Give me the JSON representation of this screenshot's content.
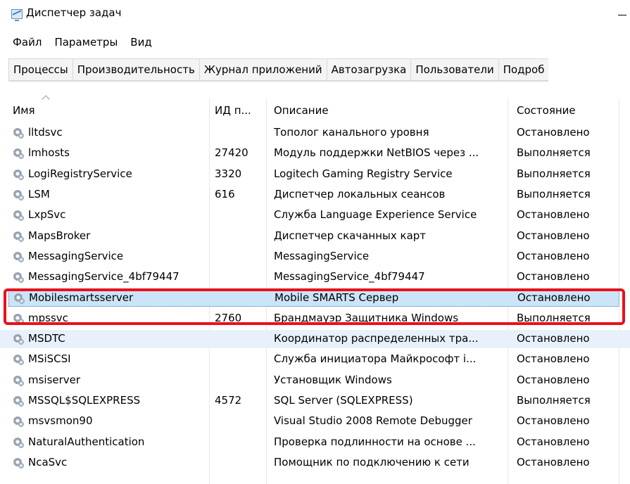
{
  "window": {
    "title": "Диспетчер задач"
  },
  "menu": [
    "Файл",
    "Параметры",
    "Вид"
  ],
  "tabs": [
    "Процессы",
    "Производительность",
    "Журнал приложений",
    "Автозагрузка",
    "Пользователи",
    "Подроб"
  ],
  "columns": {
    "name": "Имя",
    "pid": "ИД п...",
    "description": "Описание",
    "status": "Состояние"
  },
  "rows": [
    {
      "name": "lltdsvc",
      "pid": "",
      "description": "Тополог канального уровня",
      "status": "Остановлено"
    },
    {
      "name": "lmhosts",
      "pid": "27420",
      "description": "Модуль поддержки NetBIOS через ...",
      "status": "Выполняется"
    },
    {
      "name": "LogiRegistryService",
      "pid": "3320",
      "description": "Logitech Gaming Registry Service",
      "status": "Выполняется"
    },
    {
      "name": "LSM",
      "pid": "616",
      "description": "Диспетчер локальных сеансов",
      "status": "Выполняется"
    },
    {
      "name": "LxpSvc",
      "pid": "",
      "description": "Служба Language Experience Service",
      "status": "Остановлено"
    },
    {
      "name": "MapsBroker",
      "pid": "",
      "description": "Диспетчер скачанных карт",
      "status": "Остановлено"
    },
    {
      "name": "MessagingService",
      "pid": "",
      "description": "MessagingService",
      "status": "Остановлено"
    },
    {
      "name": "MessagingService_4bf79447",
      "pid": "",
      "description": "MessagingService_4bf79447",
      "status": "Остановлено"
    },
    {
      "name": "Mobilesmartsserver",
      "pid": "",
      "description": "Mobile SMARTS Сервер",
      "status": "Остановлено"
    },
    {
      "name": "mpssvc",
      "pid": "2760",
      "description": "Брандмауэр Защитника Windows",
      "status": "Выполняется"
    },
    {
      "name": "MSDTC",
      "pid": "",
      "description": "Координатор распределенных тра...",
      "status": "Остановлено"
    },
    {
      "name": "MSiSCSI",
      "pid": "",
      "description": "Служба инициатора Майкрософт i...",
      "status": "Остановлено"
    },
    {
      "name": "msiserver",
      "pid": "",
      "description": "Установщик Windows",
      "status": "Остановлено"
    },
    {
      "name": "MSSQL$SQLEXPRESS",
      "pid": "4572",
      "description": "SQL Server (SQLEXPRESS)",
      "status": "Выполняется"
    },
    {
      "name": "msvsmon90",
      "pid": "",
      "description": "Visual Studio 2008 Remote Debugger",
      "status": "Остановлено"
    },
    {
      "name": "NaturalAuthentication",
      "pid": "",
      "description": "Проверка подлинности на основе ...",
      "status": "Остановлено"
    },
    {
      "name": "NcaSvc",
      "pid": "",
      "description": "Помощник по подключению к сети",
      "status": "Остановлено"
    }
  ],
  "colors": {
    "highlight": "#e8111b",
    "selection": "#cce4f7",
    "hover_row": "#e8f1fb"
  },
  "icons": {
    "row_icon": "service-gear-icon"
  }
}
